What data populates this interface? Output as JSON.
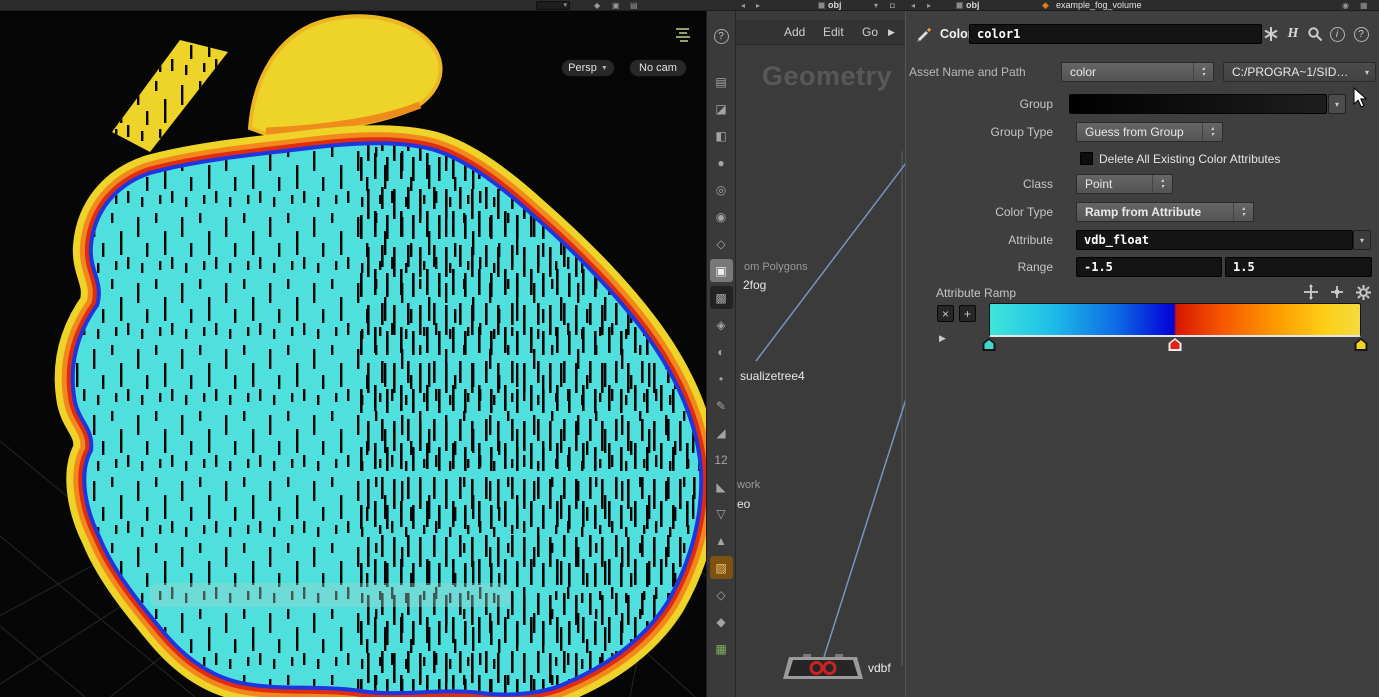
{
  "top_bar": {
    "network_context": "obj",
    "params_context": "obj",
    "params_node": "example_fog_volume"
  },
  "viewport": {
    "camera_menu": "Persp",
    "no_cam": "No cam"
  },
  "toolbar": {
    "help": "?",
    "items": [
      {
        "name": "background-image-icon",
        "glyph": "▤",
        "state": ""
      },
      {
        "name": "shade-mode-icon",
        "glyph": "◪",
        "state": ""
      },
      {
        "name": "secure-selection-icon",
        "glyph": "◧",
        "state": ""
      },
      {
        "name": "select-objects-icon",
        "glyph": "●",
        "state": ""
      },
      {
        "name": "view-tool-icon",
        "glyph": "◎",
        "state": ""
      },
      {
        "name": "lights-icon",
        "glyph": "◉",
        "state": ""
      },
      {
        "name": "camera-tool-icon",
        "glyph": "◇",
        "state": ""
      },
      {
        "name": "show-points-icon",
        "glyph": "▣",
        "state": "active-light"
      },
      {
        "name": "show-primitives-icon",
        "glyph": "▩",
        "state": "pressed"
      },
      {
        "name": "normals-icon",
        "glyph": "◈",
        "state": ""
      },
      {
        "name": "shade-half-icon",
        "glyph": "◐",
        "state": ""
      },
      {
        "name": "point-marker-icon",
        "glyph": "•",
        "state": ""
      },
      {
        "name": "draw-icon",
        "glyph": "✎",
        "state": ""
      },
      {
        "name": "wedge-icon",
        "glyph": "◢",
        "state": ""
      },
      {
        "name": "point-numbers-icon",
        "glyph": "12",
        "state": ""
      },
      {
        "name": "corner-icon",
        "glyph": "◣",
        "state": ""
      },
      {
        "name": "triangle-down-icon",
        "glyph": "▽",
        "state": ""
      },
      {
        "name": "triangle-up-icon",
        "glyph": "▲",
        "state": ""
      },
      {
        "name": "visualizer-icon",
        "glyph": "▨",
        "state": "active-orange"
      },
      {
        "name": "diamond-icon",
        "glyph": "◇",
        "state": ""
      },
      {
        "name": "solid-diamond-icon",
        "glyph": "◆",
        "state": ""
      },
      {
        "name": "grid-display-icon",
        "glyph": "▦",
        "state": "green"
      }
    ]
  },
  "network": {
    "menu": {
      "add": "Add",
      "edit": "Edit",
      "go": "Go",
      "more": "▶"
    },
    "watermark": "Geometry",
    "labels": {
      "from_polygons": "om Polygons",
      "fog": "2fog",
      "visualize": "sualizetree4",
      "work": "work",
      "eo": "eo"
    },
    "node_label": "vdbf"
  },
  "params": {
    "header": {
      "type": "Color",
      "name": "color1"
    },
    "asset": {
      "label": "Asset Name and Path",
      "name_value": "color",
      "path_value": "C:/PROGRA~1/SID…"
    },
    "group": {
      "label": "Group",
      "value": ""
    },
    "group_type": {
      "label": "Group Type",
      "value": "Guess from Group"
    },
    "delete_attrs": {
      "label": "Delete All Existing Color Attributes",
      "checked": false
    },
    "class": {
      "label": "Class",
      "value": "Point"
    },
    "color_type": {
      "label": "Color Type",
      "value": "Ramp from Attribute"
    },
    "attribute": {
      "label": "Attribute",
      "value": "vdb_float"
    },
    "range": {
      "label": "Range",
      "min": "-1.5",
      "max": "1.5"
    },
    "ramp": {
      "label": "Attribute Ramp",
      "delete_button": "×",
      "add_button": "+",
      "stops": [
        {
          "pos": 0,
          "color": "#3ee6da"
        },
        {
          "pos": 0.16,
          "color": "#1fc0e8"
        },
        {
          "pos": 0.34,
          "color": "#0d6ce4"
        },
        {
          "pos": 0.46,
          "color": "#0418dc"
        },
        {
          "pos": 0.497,
          "color": "#0404d2"
        },
        {
          "pos": 0.503,
          "color": "#d81600"
        },
        {
          "pos": 0.62,
          "color": "#f55300"
        },
        {
          "pos": 0.76,
          "color": "#fc9500"
        },
        {
          "pos": 0.9,
          "color": "#ffcd14"
        },
        {
          "pos": 1,
          "color": "#f3dc40"
        }
      ],
      "markers": [
        {
          "pos": 0,
          "color": "#3fd8cc",
          "selected": false
        },
        {
          "pos": 0.5,
          "color": "#df2314",
          "selected": true
        },
        {
          "pos": 1,
          "color": "#efd228",
          "selected": false
        }
      ]
    }
  },
  "colors": {
    "volume_interior": "#4fe0de",
    "volume_band_blue": "#1f35de",
    "volume_band_red": "#e02c10",
    "volume_band_orange": "#f2881c",
    "volume_band_yellow": "#eed32b",
    "wire": "#7694bd",
    "panel_bg": "#3f3f3f",
    "field_bg": "#141414"
  }
}
